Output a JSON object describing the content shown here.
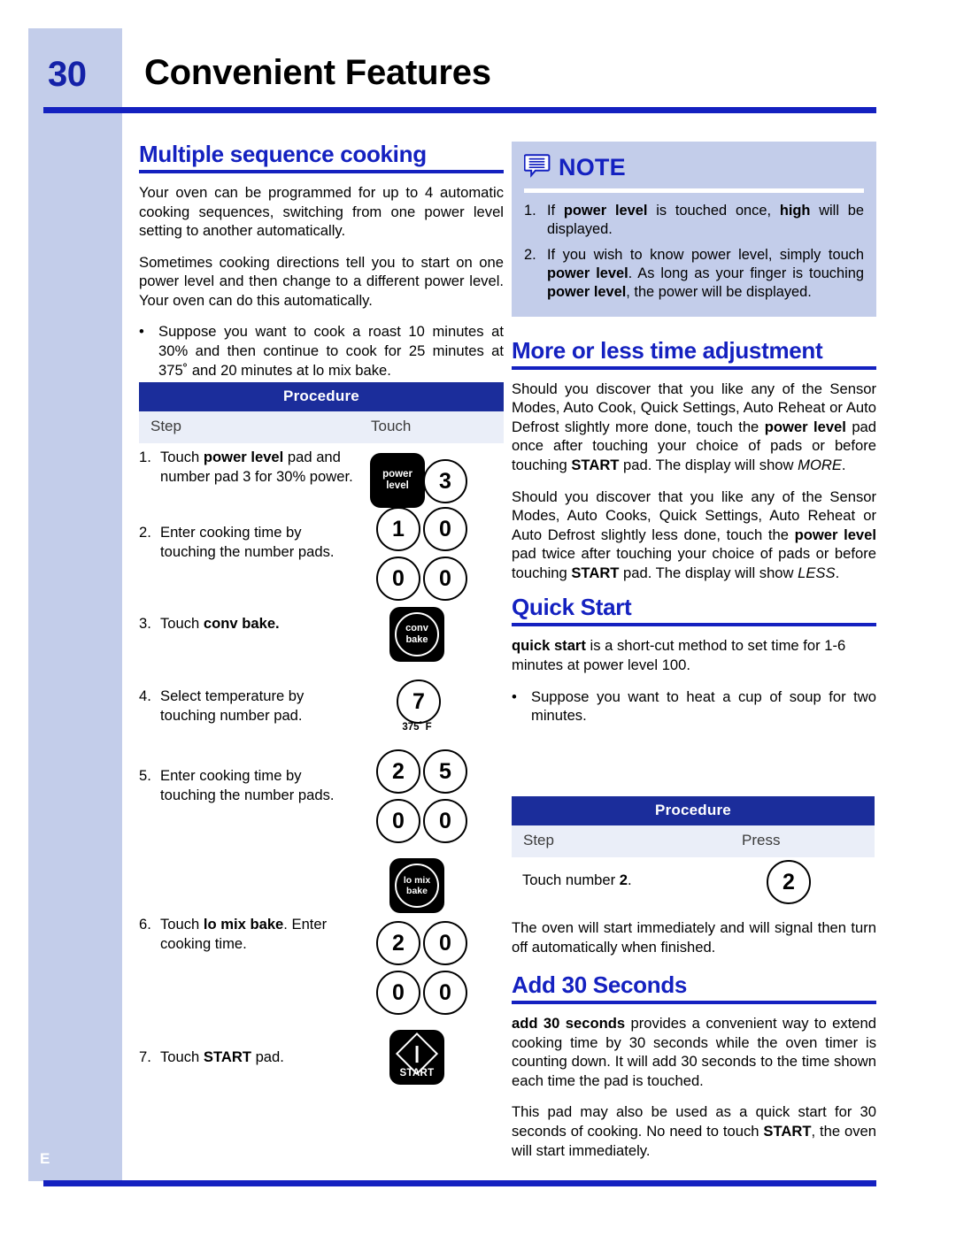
{
  "page": {
    "number": "30",
    "title": "Convenient Features",
    "side_letter": "E",
    "accent_blue": "#1421c0",
    "band_blue": "#c3cdea",
    "table_header_blue": "#1b2d9b"
  },
  "left_column": {
    "section_title": "Multiple sequence cooking",
    "paragraphs": [
      "Your oven can be programmed for up to 4 automatic cooking sequences, switching from one power level setting to another automatically.",
      "Sometimes cooking directions tell you to start on one power level and then change to a different power level. Your oven can do this automatically."
    ],
    "bullet": {
      "marker": "•",
      "text_parts": [
        "Suppose you want to cook a roast 10 minutes at 30% and then continue to cook for 25 minutes at 375˚ and 20 minutes at lo mix bake."
      ]
    },
    "procedure": {
      "title": "Procedure",
      "col_step": "Step",
      "col_touch": "Touch",
      "steps": [
        {
          "num": "1.",
          "text_plain": "Touch power level pad and number pad 3 for 30% power.",
          "bold_run": "power level"
        },
        {
          "num": "2.",
          "text_plain": "Enter cooking time by touching the number pads.",
          "bold_run": ""
        },
        {
          "num": "3.",
          "text_plain": "Touch conv bake.",
          "bold_run": "conv bake."
        },
        {
          "num": "4.",
          "text_plain": "Select temperature by touching number pad.",
          "bold_run": ""
        },
        {
          "num": "5.",
          "text_plain": "Enter cooking time by touching the number pads.",
          "bold_run": ""
        },
        {
          "num": "6.",
          "text_plain": "Touch lo mix bake. Enter cooking time.",
          "bold_run": "lo mix bake"
        },
        {
          "num": "7.",
          "text_plain": "Touch START pad.",
          "bold_run": "START"
        }
      ],
      "pads": {
        "power_level": {
          "line1": "power",
          "line2": "level"
        },
        "conv_bake": {
          "line1": "conv",
          "line2": "bake"
        },
        "lo_mix_bake": {
          "line1": "lo mix",
          "line2": "bake"
        },
        "start": {
          "label": "START"
        },
        "digit_3": "3",
        "digit_1": "1",
        "digits_row1": [
          "1",
          "0"
        ],
        "digits_row2": [
          "0",
          "0"
        ],
        "digit_7": "7",
        "temp_caption": "375˚ F",
        "digits_row3": [
          "2",
          "5"
        ],
        "digits_row4": [
          "0",
          "0"
        ],
        "digits_row5": [
          "2",
          "0"
        ],
        "digits_row6": [
          "0",
          "0"
        ]
      }
    }
  },
  "right_column": {
    "note": {
      "icon": "note-bubble-icon",
      "title": "NOTE",
      "items": [
        {
          "num": "1.",
          "text": "If power level is touched once, high will be displayed."
        },
        {
          "num": "2.",
          "text": "If you wish to know power level, simply touch power level. As long as your finger is touching power level, the power will be displayed."
        }
      ]
    },
    "more_less": {
      "title": "More or less time adjustment",
      "paragraph1": "Should you discover that you like any of the Sensor Modes, Auto Cook, Quick Settings, Auto Reheat or Auto Defrost slightly more done, touch the power level pad once after touching your choice of pads or before touching START pad. The display will show MORE.",
      "paragraph2": "Should you discover that you like any of the Sensor Modes, Auto Cooks, Quick Settings, Auto Reheat or Auto Defrost slightly less done, touch the power level pad twice after touching your choice of pads or before touching START pad. The display will show LESS."
    },
    "quick_start": {
      "title": "Quick Start",
      "paragraph": "quick start is a short-cut method to set time for 1-6 minutes at power level 100.",
      "bullet_marker": "•",
      "bullet": "Suppose you want to heat a cup of soup for two minutes.",
      "procedure": {
        "title": "Procedure",
        "col_step": "Step",
        "col_press": "Press",
        "row_text": "Touch number 2.",
        "row_pad": "2"
      },
      "closing": "The oven will start immediately and will signal then turn off automatically when finished."
    },
    "add30": {
      "title": "Add 30 Seconds",
      "paragraph1": "add 30 seconds provides a convenient way to extend cooking time by 30 seconds while the oven timer is counting down. It will add 30 seconds to the time shown each time the pad is touched.",
      "paragraph2": "This pad may also be used as a quick start for 30 seconds of cooking. No need to touch START, the oven will start immediately."
    }
  }
}
